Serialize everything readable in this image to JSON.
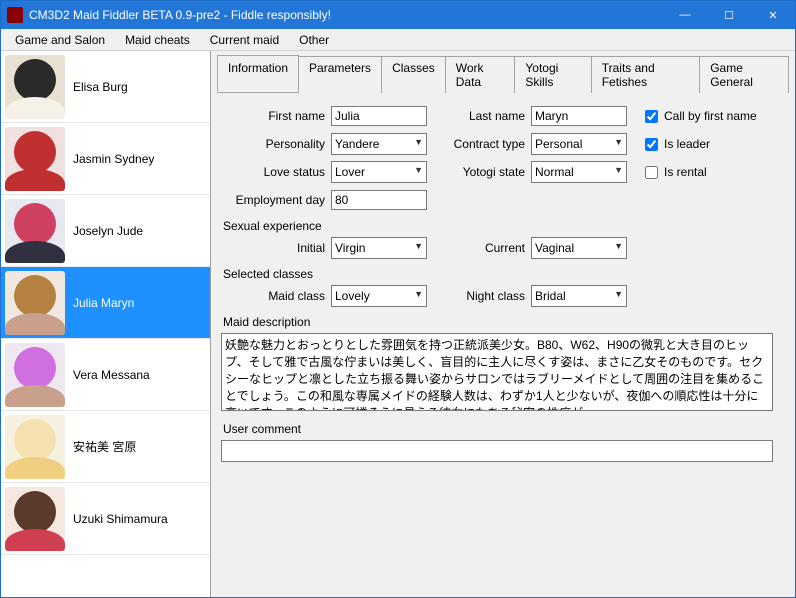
{
  "window": {
    "title": "CM3D2 Maid Fiddler BETA 0.9-pre2 - Fiddle responsibly!",
    "min": "—",
    "max": "☐",
    "close": "✕"
  },
  "menubar": {
    "game_salon": "Game and Salon",
    "maid_cheats": "Maid cheats",
    "current_maid": "Current maid",
    "other": "Other"
  },
  "sidebar": {
    "items": [
      {
        "name": "Elisa Burg"
      },
      {
        "name": "Jasmin Sydney"
      },
      {
        "name": "Joselyn Jude"
      },
      {
        "name": "Julia Maryn"
      },
      {
        "name": "Vera Messana"
      },
      {
        "name": "安祐美 宮原"
      },
      {
        "name": "Uzuki Shimamura"
      }
    ],
    "selected_index": 3
  },
  "tabs": {
    "information": "Information",
    "parameters": "Parameters",
    "classes": "Classes",
    "work_data": "Work Data",
    "yotogi_skills": "Yotogi Skills",
    "traits_fetishes": "Traits and Fetishes",
    "game_general": "Game General"
  },
  "info": {
    "first_name_label": "First name",
    "first_name": "Julia",
    "last_name_label": "Last name",
    "last_name": "Maryn",
    "call_by_first_label": "Call by first name",
    "call_by_first": true,
    "personality_label": "Personality",
    "personality": "Yandere",
    "contract_label": "Contract type",
    "contract": "Personal",
    "is_leader_label": "Is leader",
    "is_leader": true,
    "love_status_label": "Love status",
    "love_status": "Lover",
    "yotogi_state_label": "Yotogi state",
    "yotogi_state": "Normal",
    "is_rental_label": "Is rental",
    "is_rental": false,
    "employment_label": "Employment day",
    "employment_day": "80",
    "sexual_exp_label": "Sexual experience",
    "initial_label": "Initial",
    "initial": "Virgin",
    "current_label": "Current",
    "current": "Vaginal",
    "selected_classes_label": "Selected classes",
    "maid_class_label": "Maid class",
    "maid_class": "Lovely",
    "night_class_label": "Night class",
    "night_class": "Bridal",
    "desc_label": "Maid description",
    "desc": "妖艶な魅力とおっとりとした雰囲気を持つ正統派美少女。B80、W62、H90の微乳と大き目のヒップ、そして雅で古風な佇まいは美しく、盲目的に主人に尽くす姿は、まさに乙女そのものです。セクシーなヒップと凛とした立ち振る舞い姿からサロンではラブリーメイドとして周囲の注目を集めることでしょう。この和風な専属メイドの経験人数は、わずか1人と少ないが、夜伽への順応性は十分に高いです。このように可憐そうに見える彼女にもある秘密の性癖が…",
    "comment_label": "User comment",
    "comment": ""
  }
}
